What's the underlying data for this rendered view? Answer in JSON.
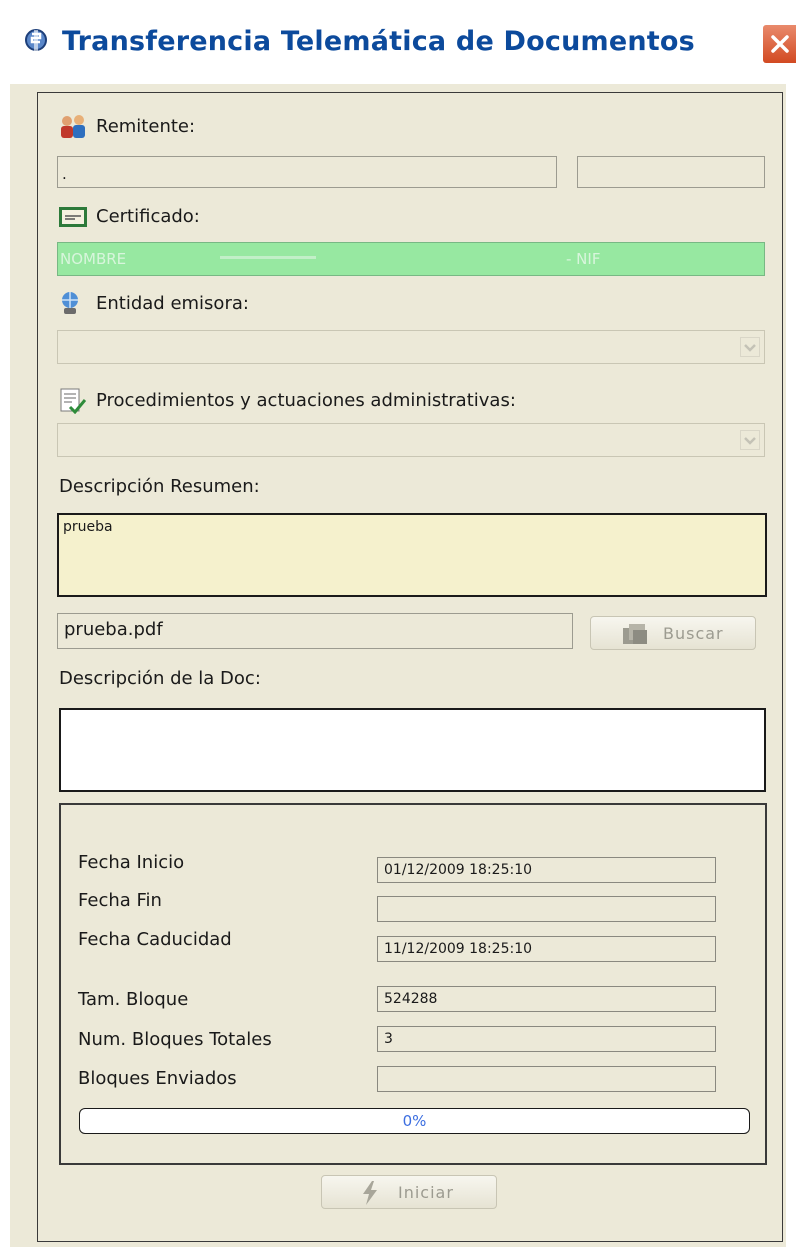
{
  "window": {
    "title": "Transferencia Telemática de Documentos"
  },
  "sender": {
    "label": "Remitente:",
    "value": ".",
    "value2": ""
  },
  "certificate": {
    "label": "Certificado:",
    "name_prefix": "NOMBRE",
    "nif_label": "- NIF"
  },
  "issuer": {
    "label": "Entidad emisora:",
    "selected": ""
  },
  "procedures": {
    "label": "Procedimientos y actuaciones administrativas:",
    "selected": ""
  },
  "summary": {
    "label": "Descripción Resumen:",
    "value": "prueba"
  },
  "file": {
    "value": "prueba.pdf",
    "browse_label": "Buscar"
  },
  "doc_description": {
    "label": "Descripción de la Doc:",
    "value": ""
  },
  "details": {
    "start_date_label": "Fecha Inicio",
    "start_date": "01/12/2009 18:25:10",
    "end_date_label": "Fecha Fin",
    "end_date": "",
    "expiry_date_label": "Fecha Caducidad",
    "expiry_date": "11/12/2009 18:25:10",
    "block_size_label": "Tam. Bloque",
    "block_size": "524288",
    "total_blocks_label": "Num. Bloques Totales",
    "total_blocks": "3",
    "sent_blocks_label": "Bloques Enviados",
    "sent_blocks": ""
  },
  "progress": {
    "label": "0%",
    "fraction": 0
  },
  "actions": {
    "start_label": "Iniciar"
  },
  "colors": {
    "title": "#0c4a9c",
    "certificate_bg": "#97e8a1",
    "summary_bg": "#f5f1cd",
    "progress": "#3c6ee0",
    "close": "#d24a22"
  }
}
